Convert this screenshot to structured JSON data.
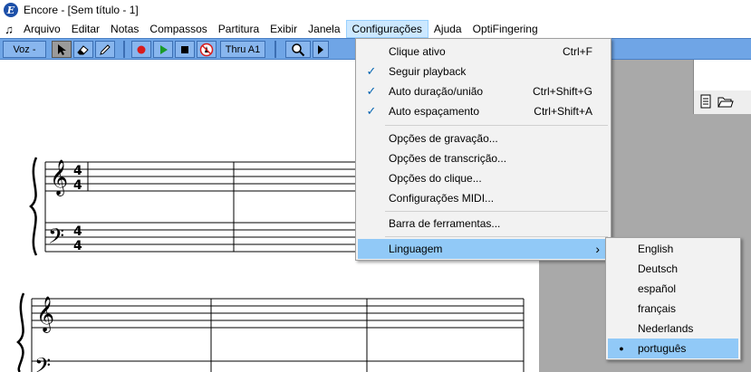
{
  "window": {
    "title": "Encore - [Sem título - 1]",
    "icon": "encore-logo",
    "icon_letter": "E"
  },
  "menubar": {
    "note_icon": "♫",
    "items": [
      "Arquivo",
      "Editar",
      "Notas",
      "Compassos",
      "Partitura",
      "Exibir",
      "Janela",
      "Configurações",
      "Ajuda",
      "OptiFingering"
    ]
  },
  "toolbar": {
    "voice_label": "Voz -",
    "thru_label": "Thru A1",
    "icons": [
      "arrow-pointer-icon",
      "eraser-icon",
      "pencil-icon",
      "record-icon",
      "play-icon",
      "stop-icon",
      "no-metronome-icon",
      "magnifier-icon",
      "step-forward-icon"
    ]
  },
  "config_menu": {
    "items": [
      {
        "label": "Clique ativo",
        "shortcut": "Ctrl+F",
        "checked": false
      },
      {
        "label": "Seguir playback",
        "shortcut": "",
        "checked": true
      },
      {
        "label": "Auto duração/união",
        "shortcut": "Ctrl+Shift+G",
        "checked": true
      },
      {
        "label": "Auto espaçamento",
        "shortcut": "Ctrl+Shift+A",
        "checked": true
      },
      {
        "label": "Opções de gravação...",
        "shortcut": "",
        "checked": false
      },
      {
        "label": "Opções de transcrição...",
        "shortcut": "",
        "checked": false
      },
      {
        "label": "Opções do clique...",
        "shortcut": "",
        "checked": false
      },
      {
        "label": "Configurações MIDI...",
        "shortcut": "",
        "checked": false
      },
      {
        "label": "Barra de ferramentas...",
        "shortcut": "",
        "checked": false
      },
      {
        "label": "Linguagem",
        "shortcut": "",
        "checked": false,
        "submenu": true
      }
    ],
    "check_glyph": "✓",
    "submenu_arrow": "›"
  },
  "language_menu": {
    "items": [
      "English",
      "Deutsch",
      "español",
      "français",
      "Nederlands",
      "português"
    ],
    "selected_index": 5,
    "bullet_glyph": "●"
  },
  "score": {
    "time_signature_top": "4",
    "time_signature_bottom": "4",
    "treble_clef": "𝄞",
    "bass_clef": "𝄢"
  },
  "colors": {
    "toolbar": "#6fa5e6",
    "menu_highlight": "#91c9f7",
    "check": "#0063b1",
    "score_background_right": "#a9a9a9"
  }
}
